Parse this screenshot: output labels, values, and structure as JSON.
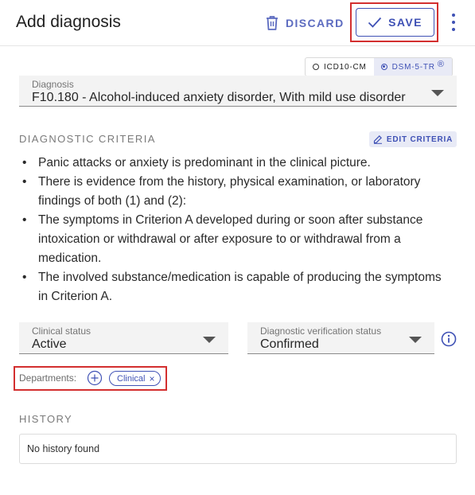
{
  "header": {
    "title": "Add diagnosis",
    "discard_label": "DISCARD",
    "save_label": "SAVE"
  },
  "code_system": {
    "options": [
      {
        "label": "ICD10-CM",
        "selected": false
      },
      {
        "label": "DSM-5-TR",
        "selected": true
      }
    ],
    "registered_mark": "®"
  },
  "diagnosis": {
    "label": "Diagnosis",
    "value": "F10.180 - Alcohol-induced anxiety disorder, With mild use disorder"
  },
  "criteria": {
    "heading": "DIAGNOSTIC CRITERIA",
    "edit_label": "EDIT CRITERIA",
    "items": [
      "Panic attacks or anxiety is predominant in the clinical picture.",
      "There is evidence from the history, physical examination, or laboratory findings of both (1) and (2):",
      "The symptoms in Criterion A developed during or soon after substance intoxication or withdrawal or after exposure to or withdrawal from a medication.",
      "The involved substance/medication is capable of producing the symptoms in Criterion A."
    ]
  },
  "clinical_status": {
    "label": "Clinical status",
    "value": "Active"
  },
  "verification_status": {
    "label": "Diagnostic verification status",
    "value": "Confirmed"
  },
  "departments": {
    "label": "Departments:",
    "chips": [
      "Clinical"
    ],
    "remove_glyph": "×"
  },
  "history": {
    "heading": "HISTORY",
    "empty_text": "No history found"
  },
  "colors": {
    "accent": "#3f51b5",
    "highlight_outline": "#d32f2f",
    "field_background": "#f3f3f3"
  },
  "icons": [
    "trash-icon",
    "check-icon",
    "more-vert-icon",
    "edit-icon",
    "info-icon",
    "add-circle-icon",
    "close-icon",
    "dropdown-arrow-icon"
  ]
}
